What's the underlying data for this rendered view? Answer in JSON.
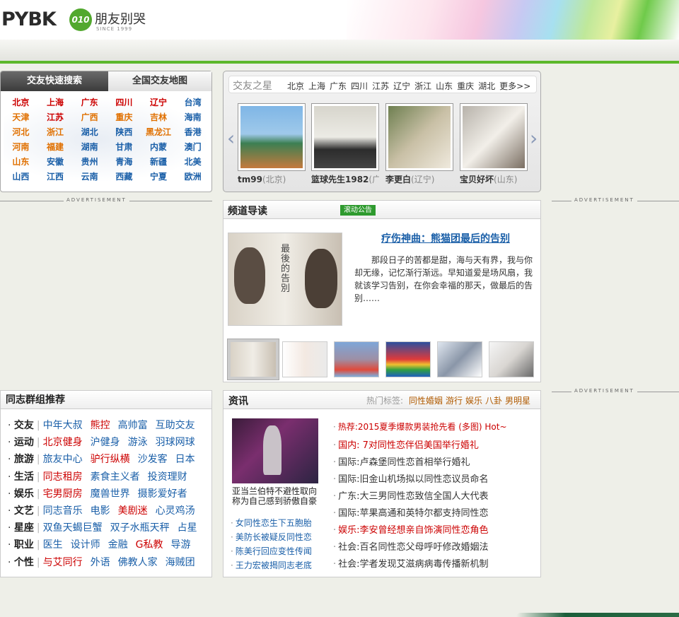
{
  "header": {
    "logo_text": "PYBK",
    "logo_badge": "010",
    "logo_cn": "朋友别哭",
    "logo_since": "SINCE 1999"
  },
  "city_search": {
    "tab_active": "交友快速搜索",
    "tab_inactive": "全国交友地图",
    "cities": [
      {
        "name": "北京",
        "color": "#cc0000"
      },
      {
        "name": "上海",
        "color": "#cc0000"
      },
      {
        "name": "广东",
        "color": "#cc0000"
      },
      {
        "name": "四川",
        "color": "#cc0000"
      },
      {
        "name": "辽宁",
        "color": "#cc0000"
      },
      {
        "name": "台湾",
        "color": "#1a5fa8"
      },
      {
        "name": "天津",
        "color": "#e07000"
      },
      {
        "name": "江苏",
        "color": "#cc0000"
      },
      {
        "name": "广西",
        "color": "#e07000"
      },
      {
        "name": "重庆",
        "color": "#e07000"
      },
      {
        "name": "吉林",
        "color": "#e07000"
      },
      {
        "name": "海南",
        "color": "#1a5fa8"
      },
      {
        "name": "河北",
        "color": "#e07000"
      },
      {
        "name": "浙江",
        "color": "#e07000"
      },
      {
        "name": "湖北",
        "color": "#1a5fa8"
      },
      {
        "name": "陕西",
        "color": "#1a5fa8"
      },
      {
        "name": "黑龙江",
        "color": "#e07000"
      },
      {
        "name": "香港",
        "color": "#1a5fa8"
      },
      {
        "name": "河南",
        "color": "#e07000"
      },
      {
        "name": "福建",
        "color": "#e07000"
      },
      {
        "name": "湖南",
        "color": "#1a5fa8"
      },
      {
        "name": "甘肃",
        "color": "#1a5fa8"
      },
      {
        "name": "内蒙",
        "color": "#1a5fa8"
      },
      {
        "name": "澳门",
        "color": "#1a5fa8"
      },
      {
        "name": "山东",
        "color": "#e07000"
      },
      {
        "name": "安徽",
        "color": "#1a5fa8"
      },
      {
        "name": "贵州",
        "color": "#1a5fa8"
      },
      {
        "name": "青海",
        "color": "#1a5fa8"
      },
      {
        "name": "新疆",
        "color": "#1a5fa8"
      },
      {
        "name": "北美",
        "color": "#1a5fa8"
      },
      {
        "name": "山西",
        "color": "#1a5fa8"
      },
      {
        "name": "江西",
        "color": "#1a5fa8"
      },
      {
        "name": "云南",
        "color": "#1a5fa8"
      },
      {
        "name": "西藏",
        "color": "#1a5fa8"
      },
      {
        "name": "宁夏",
        "color": "#1a5fa8"
      },
      {
        "name": "欧洲",
        "color": "#1a5fa8"
      }
    ]
  },
  "stars": {
    "title": "交友之星",
    "cities": [
      "北京",
      "上海",
      "广东",
      "四川",
      "江苏",
      "辽宁",
      "浙江",
      "山东",
      "重庆",
      "湖北",
      "更多>>"
    ],
    "profiles": [
      {
        "name": "tm99",
        "region": "(北京)",
        "bg": "linear-gradient(#7fb6e6 0%,#9fc9ea 45%,#3c7f52 60%,#c57a3d 100%)"
      },
      {
        "name": "篮球先生1982",
        "region": "(广",
        "bg": "linear-gradient(#d7d5cc 0%,#ecebe5 50%,#2c2c2c 70%,#444 100%)"
      },
      {
        "name": "李更白",
        "region": "(辽宁)",
        "bg": "linear-gradient(135deg,#6e7f50 0%,#c9c0a6 50%,#efe9dd 100%)"
      },
      {
        "name": "宝贝好坏",
        "region": "(山东)",
        "bg": "linear-gradient(135deg,#b7b2aa 0%,#f2efe9 50%,#7a6e62 100%)"
      }
    ]
  },
  "advertisement": "ADVERTISEMENT",
  "channel": {
    "title": "频道导读",
    "notice": "滚动公告",
    "feature_title": "疗伤神曲：熊猫团最后的告别",
    "feature_image_text": "最後的告別",
    "feature_desc": "那段日子的苦都是甜，海与天有界，我与你却无缘，记忆渐行渐远。早知道爱是场风扇，我就该学习告别，在你会幸福的那天，做最后的告别……",
    "thumbs": [
      "linear-gradient(90deg,#d9d2c6,#f0ede6,#c8bfb2)",
      "linear-gradient(90deg,#ffffff,#f3e9e2,#eaeaea)",
      "linear-gradient(#7ea6d8 0%,#9d8fa5 50%,#e04a3a 80%,#7ab0e0 100%)",
      "linear-gradient(#2c4f9e 0%,#e03a3a 50%,#f0c030 65%,#30a040 80%,#2060c0 100%)",
      "linear-gradient(135deg,#dfe6ef 0%,#8a96a8 50%,#ffffff 100%)",
      "linear-gradient(135deg,#f5f5f5 0%,#d9d6d2 50%,#6a6a6a 100%)"
    ]
  },
  "groups": {
    "title": "同志群组推荐",
    "rows": [
      {
        "cat": "交友",
        "items": [
          {
            "t": "中年大叔",
            "c": "#1a5fa8"
          },
          {
            "t": "熊控",
            "c": "#cc0000"
          },
          {
            "t": "高帅富",
            "c": "#1a5fa8"
          },
          {
            "t": "互助交友",
            "c": "#1a5fa8"
          }
        ]
      },
      {
        "cat": "运动",
        "items": [
          {
            "t": "北京健身",
            "c": "#cc0000"
          },
          {
            "t": "沪健身",
            "c": "#1a5fa8"
          },
          {
            "t": "游泳",
            "c": "#1a5fa8"
          },
          {
            "t": "羽球网球",
            "c": "#1a5fa8"
          }
        ]
      },
      {
        "cat": "旅游",
        "items": [
          {
            "t": "旅友中心",
            "c": "#1a5fa8"
          },
          {
            "t": "驴行纵横",
            "c": "#cc0000"
          },
          {
            "t": "沙发客",
            "c": "#1a5fa8"
          },
          {
            "t": "日本",
            "c": "#1a5fa8"
          }
        ]
      },
      {
        "cat": "生活",
        "items": [
          {
            "t": "同志租房",
            "c": "#cc0000"
          },
          {
            "t": "素食主义者",
            "c": "#1a5fa8"
          },
          {
            "t": "投资理财",
            "c": "#1a5fa8"
          }
        ]
      },
      {
        "cat": "娱乐",
        "items": [
          {
            "t": "宅男厨房",
            "c": "#cc0000"
          },
          {
            "t": "魔兽世界",
            "c": "#1a5fa8"
          },
          {
            "t": "摄影爱好者",
            "c": "#1a5fa8"
          }
        ]
      },
      {
        "cat": "文艺",
        "items": [
          {
            "t": "同志音乐",
            "c": "#1a5fa8"
          },
          {
            "t": "电影",
            "c": "#1a5fa8"
          },
          {
            "t": "美剧迷",
            "c": "#cc0000"
          },
          {
            "t": "心灵鸡汤",
            "c": "#1a5fa8"
          }
        ]
      },
      {
        "cat": "星座",
        "items": [
          {
            "t": "双鱼天蝎巨蟹",
            "c": "#1a5fa8"
          },
          {
            "t": "双子水瓶天秤",
            "c": "#1a5fa8"
          },
          {
            "t": "占星",
            "c": "#1a5fa8"
          }
        ]
      },
      {
        "cat": "职业",
        "items": [
          {
            "t": "医生",
            "c": "#1a5fa8"
          },
          {
            "t": "设计师",
            "c": "#1a5fa8"
          },
          {
            "t": "金融",
            "c": "#1a5fa8"
          },
          {
            "t": "G私教",
            "c": "#cc0000"
          },
          {
            "t": "导游",
            "c": "#1a5fa8"
          }
        ]
      },
      {
        "cat": "个性",
        "items": [
          {
            "t": "与艾同行",
            "c": "#cc0000"
          },
          {
            "t": "外语",
            "c": "#1a5fa8"
          },
          {
            "t": "佛教人家",
            "c": "#1a5fa8"
          },
          {
            "t": "海贼团",
            "c": "#1a5fa8"
          }
        ]
      }
    ]
  },
  "news": {
    "title": "资讯",
    "hot_label": "热门标签:",
    "hot_tags": [
      "同性婚姻",
      "游行",
      "娱乐",
      "八卦",
      "男明星"
    ],
    "image_caption": "亚当兰伯特不避性取向称为自己感到骄傲自豪",
    "left_items": [
      "女同性恋生下五胞胎",
      "美防长被疑反同性恋",
      "陈美行回应变性传闻",
      "王力宏被揭同志老底"
    ],
    "right_items": [
      {
        "t": "热荐:2015夏季爆款男装抢先看 (多图) Hot~",
        "c": "#cc0000",
        "s": "12px"
      },
      {
        "t": "国内: 7对同性恋伴侣美国举行婚礼",
        "c": "#cc0000",
        "s": "13px"
      },
      {
        "t": "国际:卢森堡同性恋首相举行婚礼",
        "c": "#333333",
        "s": "13px"
      },
      {
        "t": "国际:旧金山机场拟以同性恋议员命名",
        "c": "#333333",
        "s": "13px"
      },
      {
        "t": "广东:大三男同性恋致信全国人大代表",
        "c": "#333333",
        "s": "13px"
      },
      {
        "t": "国际:苹果高通和英特尔都支持同性恋",
        "c": "#333333",
        "s": "13px"
      },
      {
        "t": "娱乐:李安曾经想亲自饰演同性恋角色",
        "c": "#cc0000",
        "s": "13px"
      },
      {
        "t": "社会:百名同性恋父母呼吁修改婚姻法",
        "c": "#333333",
        "s": "13px"
      },
      {
        "t": "社会:学者发现艾滋病病毒传播新机制",
        "c": "#333333",
        "s": "13px"
      }
    ]
  }
}
